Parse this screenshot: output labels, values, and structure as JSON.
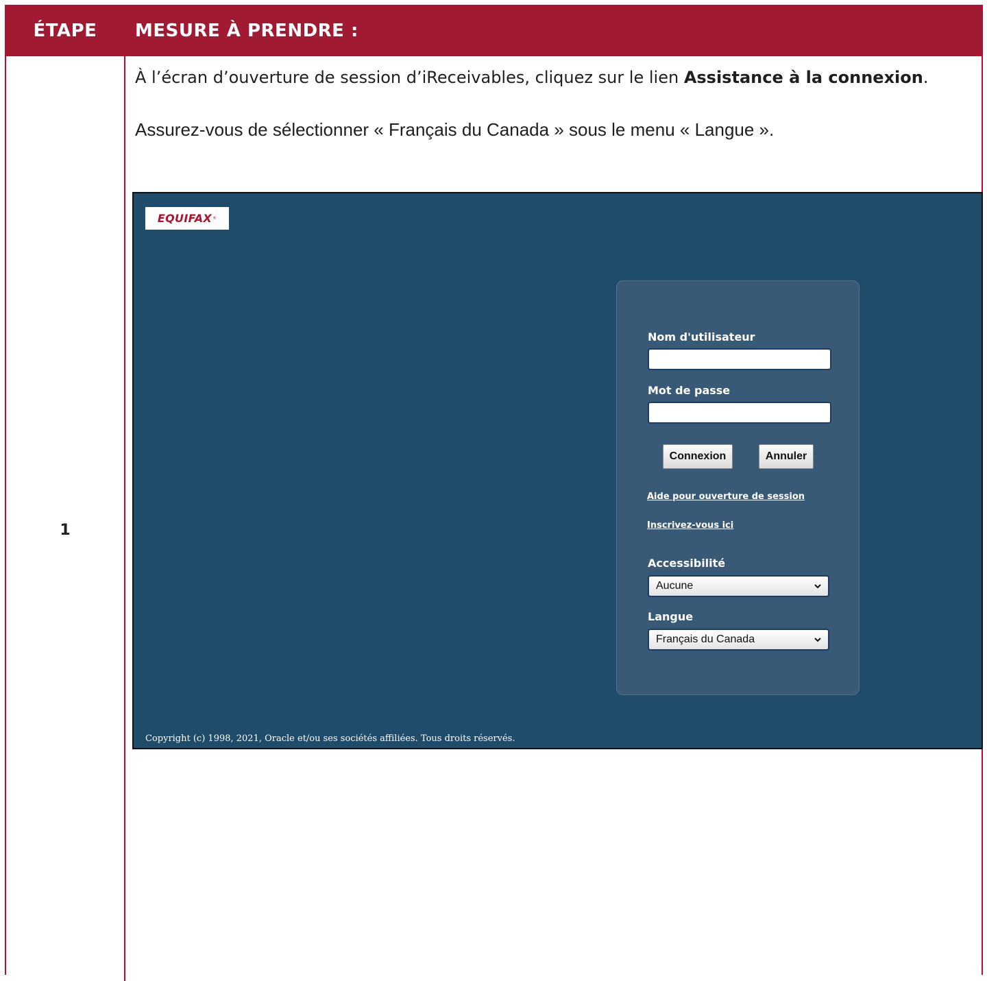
{
  "table": {
    "header": {
      "step": "ÉTAPE",
      "action": "MESURE À PRENDRE :"
    },
    "rows": [
      {
        "step": "1",
        "instruction": {
          "prefix": "À l’écran d’ouverture de session d’iReceivables, cliquez sur le lien ",
          "link_bold": "Assistance à la connexion",
          "suffix": "."
        },
        "instruction2": "Assurez-vous de sélectionner « Français du Canada » sous le menu « Langue »."
      }
    ]
  },
  "screenshot": {
    "logo": {
      "text": "EQUIFAX",
      "registered": "®",
      "brand_color": "#b0122b"
    },
    "background_color": "#204c6b",
    "login": {
      "username_label": "Nom d'utilisateur",
      "username_value": "",
      "password_label": "Mot de passe",
      "password_value": "",
      "login_button": "Connexion",
      "cancel_button": "Annuler",
      "help_link": "Aide pour ouverture de session",
      "register_link": "Inscrivez-vous ici",
      "accessibility_label": "Accessibilité",
      "accessibility_value": "Aucune",
      "language_label": "Langue",
      "language_value": "Français du Canada",
      "dropdown_icon": "chevron-down-icon"
    },
    "copyright": "Copyright (c) 1998, 2021, Oracle et/ou ses sociétés affiliées. Tous droits réservés."
  },
  "colors": {
    "header_background": "#a01a32",
    "table_border": "#ba0c2f",
    "panel_background": "#385a76"
  }
}
